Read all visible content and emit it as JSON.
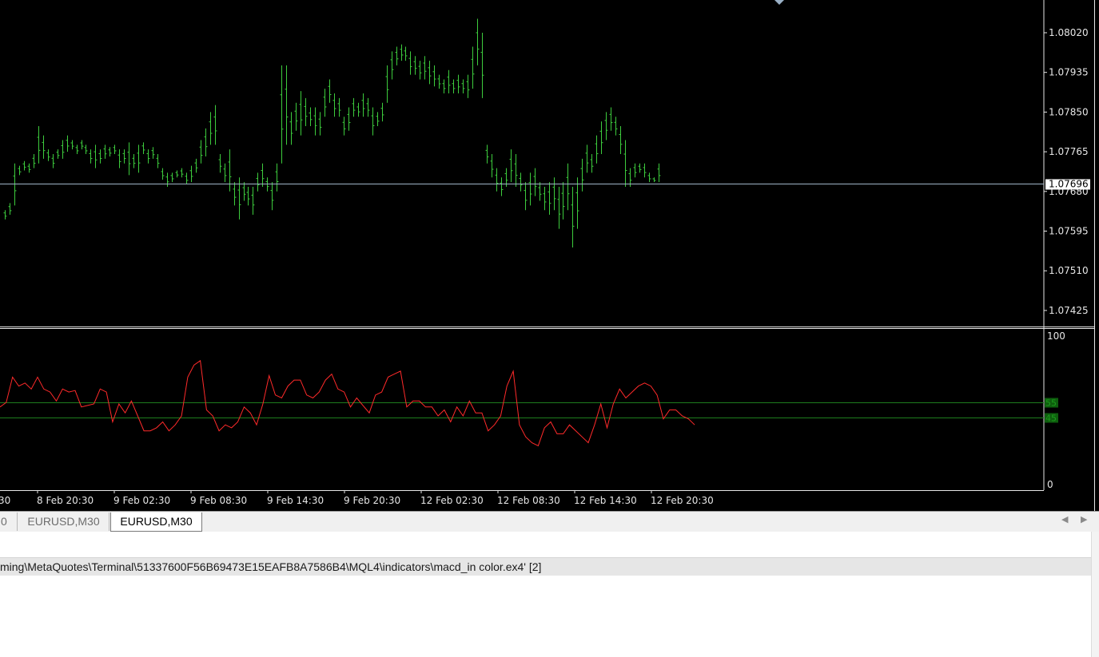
{
  "chart": {
    "colors": {
      "background": "#000000",
      "bars": "#3dcc3d",
      "price_line": "#9fb4c8",
      "indicator_line": "#ff2a2a",
      "level_line": "#1e7d1e",
      "level_label_bg": "#0e5f0e",
      "axis_text": "#e6e6e6"
    },
    "price_axis_labels": [
      "1.08020",
      "1.07935",
      "1.07850",
      "1.07765",
      "1.07680",
      "1.07595",
      "1.07510",
      "1.07425"
    ],
    "current_price_label": "1.07696",
    "indicator_axis_labels": [
      "100",
      "0"
    ],
    "indicator_levels": [
      "55",
      "45"
    ],
    "time_axis_labels": [
      ":30",
      "8 Feb 20:30",
      "9 Feb 02:30",
      "9 Feb 08:30",
      "9 Feb 14:30",
      "9 Feb 20:30",
      "12 Feb 02:30",
      "12 Feb 08:30",
      "12 Feb 14:30",
      "12 Feb 20:30"
    ]
  },
  "chart_data": {
    "type": "line",
    "series": [
      {
        "values": [
          [
            1.0764,
            1.0762
          ],
          [
            1.07655,
            1.0763
          ],
          [
            1.0774,
            1.0765
          ],
          [
            1.07735,
            1.07715
          ],
          [
            1.07745,
            1.07725
          ],
          [
            1.0774,
            1.0772
          ],
          [
            1.0776,
            1.0773
          ],
          [
            1.0782,
            1.0774
          ],
          [
            1.078,
            1.0775
          ],
          [
            1.0777,
            1.07745
          ],
          [
            1.0776,
            1.0773
          ],
          [
            1.0777,
            1.0775
          ],
          [
            1.0779,
            1.0775
          ],
          [
            1.078,
            1.07765
          ],
          [
            1.0779,
            1.0777
          ],
          [
            1.0778,
            1.0776
          ],
          [
            1.0779,
            1.0777
          ],
          [
            1.0778,
            1.0776
          ],
          [
            1.0777,
            1.0774
          ],
          [
            1.0778,
            1.0773
          ],
          [
            1.0777,
            1.0774
          ],
          [
            1.0778,
            1.0775
          ],
          [
            1.07775,
            1.07755
          ],
          [
            1.0778,
            1.0776
          ],
          [
            1.0777,
            1.0773
          ],
          [
            1.0777,
            1.0774
          ],
          [
            1.07785,
            1.07715
          ],
          [
            1.0776,
            1.0773
          ],
          [
            1.0778,
            1.0772
          ],
          [
            1.07785,
            1.0776
          ],
          [
            1.0777,
            1.0774
          ],
          [
            1.07775,
            1.0775
          ],
          [
            1.0776,
            1.0773
          ],
          [
            1.0773,
            1.07705
          ],
          [
            1.0772,
            1.0769
          ],
          [
            1.0772,
            1.077
          ],
          [
            1.07725,
            1.0771
          ],
          [
            1.0773,
            1.0771
          ],
          [
            1.0772,
            1.07695
          ],
          [
            1.07735,
            1.077
          ],
          [
            1.0775,
            1.0772
          ],
          [
            1.0779,
            1.0774
          ],
          [
            1.07815,
            1.07755
          ],
          [
            1.0785,
            1.0778
          ],
          [
            1.07865,
            1.0778
          ],
          [
            1.0776,
            1.0772
          ],
          [
            1.0774,
            1.077
          ],
          [
            1.0777,
            1.0768
          ],
          [
            1.077,
            1.0765
          ],
          [
            1.0771,
            1.0762
          ],
          [
            1.077,
            1.0766
          ],
          [
            1.0769,
            1.0765
          ],
          [
            1.0769,
            1.0763
          ],
          [
            1.0772,
            1.0768
          ],
          [
            1.0774,
            1.0769
          ],
          [
            1.0771,
            1.0768
          ],
          [
            1.077,
            1.0764
          ],
          [
            1.0774,
            1.0768
          ],
          [
            1.0795,
            1.0774
          ],
          [
            1.0795,
            1.0778
          ],
          [
            1.0785,
            1.0778
          ],
          [
            1.0787,
            1.0781
          ],
          [
            1.07895,
            1.078
          ],
          [
            1.0788,
            1.0782
          ],
          [
            1.0786,
            1.0782
          ],
          [
            1.0786,
            1.078
          ],
          [
            1.0785,
            1.078
          ],
          [
            1.079,
            1.0784
          ],
          [
            1.0792,
            1.0787
          ],
          [
            1.0789,
            1.0784
          ],
          [
            1.0788,
            1.0784
          ],
          [
            1.0784,
            1.078
          ],
          [
            1.0786,
            1.0781
          ],
          [
            1.0788,
            1.0784
          ],
          [
            1.0787,
            1.0784
          ],
          [
            1.0789,
            1.0784
          ],
          [
            1.0788,
            1.0784
          ],
          [
            1.0786,
            1.078
          ],
          [
            1.0785,
            1.0782
          ],
          [
            1.0787,
            1.0783
          ],
          [
            1.0795,
            1.0787
          ],
          [
            1.0798,
            1.0792
          ],
          [
            1.0799,
            1.0795
          ],
          [
            1.07995,
            1.0796
          ],
          [
            1.0799,
            1.0796
          ],
          [
            1.0798,
            1.0793
          ],
          [
            1.0797,
            1.0793
          ],
          [
            1.0796,
            1.0792
          ],
          [
            1.0797,
            1.0792
          ],
          [
            1.0796,
            1.0791
          ],
          [
            1.0795,
            1.07905
          ],
          [
            1.0793,
            1.079
          ],
          [
            1.0792,
            1.0789
          ],
          [
            1.0794,
            1.0789
          ],
          [
            1.0792,
            1.0789
          ],
          [
            1.0793,
            1.0789
          ],
          [
            1.0792,
            1.0789
          ],
          [
            1.0793,
            1.0788
          ],
          [
            1.0799,
            1.079
          ],
          [
            1.0805,
            1.0795
          ],
          [
            1.0802,
            1.0788
          ],
          [
            1.0778,
            1.0774
          ],
          [
            1.0776,
            1.0771
          ],
          [
            1.0773,
            1.0768
          ],
          [
            1.0771,
            1.0767
          ],
          [
            1.0773,
            1.0769
          ],
          [
            1.0777,
            1.077
          ],
          [
            1.0776,
            1.0769
          ],
          [
            1.0772,
            1.0768
          ],
          [
            1.077,
            1.0764
          ],
          [
            1.0772,
            1.0765
          ],
          [
            1.0773,
            1.0767
          ],
          [
            1.077,
            1.0766
          ],
          [
            1.0769,
            1.0764
          ],
          [
            1.077,
            1.0763
          ],
          [
            1.0771,
            1.0764
          ],
          [
            1.0769,
            1.076
          ],
          [
            1.077,
            1.0762
          ],
          [
            1.0774,
            1.0764
          ],
          [
            1.0769,
            1.0756
          ],
          [
            1.0771,
            1.076
          ],
          [
            1.0775,
            1.0768
          ],
          [
            1.0778,
            1.0772
          ],
          [
            1.0776,
            1.0772
          ],
          [
            1.078,
            1.0774
          ],
          [
            1.0783,
            1.0776
          ],
          [
            1.0785,
            1.0779
          ],
          [
            1.0786,
            1.0781
          ],
          [
            1.0784,
            1.078
          ],
          [
            1.0782,
            1.0776
          ],
          [
            1.0779,
            1.0769
          ],
          [
            1.0773,
            1.0769
          ],
          [
            1.0774,
            1.0771
          ],
          [
            1.0774,
            1.0772
          ],
          [
            1.0774,
            1.0771
          ],
          [
            1.0772,
            1.077
          ],
          [
            1.0771,
            1.077
          ],
          [
            1.0774,
            1.077
          ]
        ]
      },
      {
        "values": [
          52,
          55,
          72,
          66,
          68,
          64,
          72,
          64,
          62,
          56,
          64,
          62,
          63,
          52,
          53,
          54,
          64,
          62,
          42,
          54,
          48,
          56,
          46,
          36,
          36,
          38,
          42,
          36,
          40,
          46,
          72,
          80,
          83,
          50,
          46,
          36,
          40,
          38,
          42,
          52,
          48,
          40,
          54,
          73,
          60,
          58,
          66,
          70,
          70,
          60,
          58,
          62,
          70,
          74,
          64,
          62,
          52,
          58,
          53,
          48,
          60,
          62,
          72,
          74,
          76,
          52,
          56,
          56,
          52,
          52,
          46,
          50,
          42,
          52,
          46,
          56,
          48,
          48,
          36,
          40,
          46,
          66,
          76,
          40,
          32,
          28,
          26,
          38,
          42,
          34,
          34,
          40,
          36,
          32,
          28,
          40,
          54,
          38,
          54,
          64,
          58,
          62,
          66,
          68,
          66,
          60,
          44,
          50,
          50,
          46,
          44,
          40
        ]
      }
    ],
    "ylim": [
      1.0739,
      1.0809
    ],
    "indicator_ylim": [
      0,
      100
    ],
    "grid": false
  },
  "tabs": [
    {
      "label": "0"
    },
    {
      "label": "EURUSD,M30"
    },
    {
      "label": "EURUSD,M30"
    }
  ],
  "tab_scroll": {
    "left": "◀",
    "right": "▶"
  },
  "journal": {
    "row_text": "ming\\MetaQuotes\\Terminal\\51337600F56B69473E15EAFB8A7586B4\\MQL4\\indicators\\macd_in color.ex4' [2]"
  }
}
